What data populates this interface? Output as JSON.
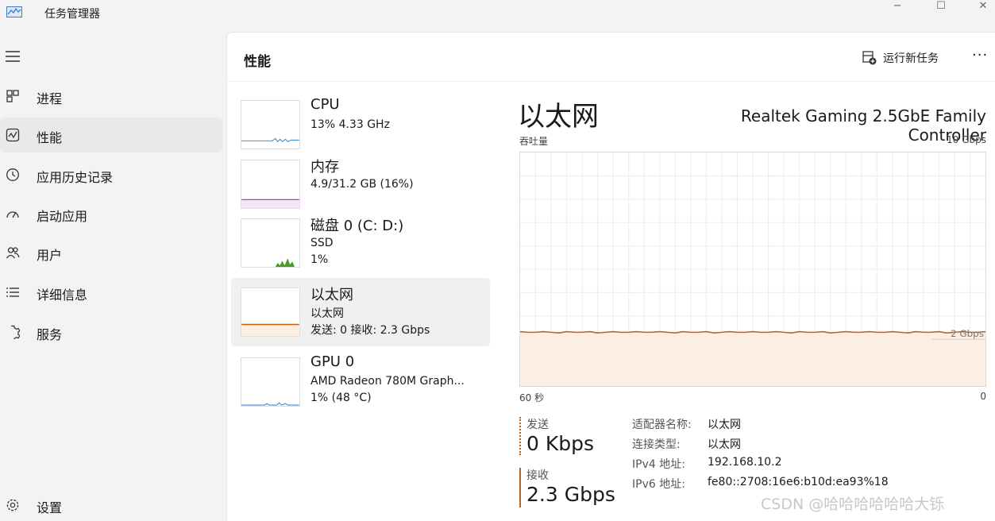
{
  "window": {
    "title": "任务管理器",
    "controls": [
      "−",
      "☐",
      "✕"
    ]
  },
  "sidebar": {
    "items": [
      {
        "label": "进程",
        "icon": "processes-icon"
      },
      {
        "label": "性能",
        "icon": "performance-icon",
        "active": true
      },
      {
        "label": "应用历史记录",
        "icon": "app-history-icon"
      },
      {
        "label": "启动应用",
        "icon": "startup-apps-icon"
      },
      {
        "label": "用户",
        "icon": "users-icon"
      },
      {
        "label": "详细信息",
        "icon": "details-icon"
      },
      {
        "label": "服务",
        "icon": "services-icon"
      }
    ],
    "settings_label": "设置"
  },
  "header": {
    "title": "性能",
    "run_new_task": "运行新任务",
    "more": "···"
  },
  "devices": [
    {
      "name": "CPU",
      "line1": "13% 4.33 GHz",
      "line2": "",
      "color": "#2a7ec9"
    },
    {
      "name": "内存",
      "line1": "4.9/31.2 GB (16%)",
      "line2": "",
      "color": "#9b2fae"
    },
    {
      "name": "磁盘 0 (C: D:)",
      "line1": "SSD",
      "line2": "1%",
      "color": "#4c9a2a"
    },
    {
      "name": "以太网",
      "line1": "以太网",
      "line2": "发送: 0 接收: 2.3 Gbps",
      "color": "#c55a11",
      "selected": true
    },
    {
      "name": "GPU 0",
      "line1": "AMD Radeon 780M Graph...",
      "line2": "1% (48 °C)",
      "color": "#2a7ec9"
    }
  ],
  "detail": {
    "title": "以太网",
    "adapter": "Realtek Gaming 2.5GbE Family Controller",
    "throughput_label": "吞吐量",
    "max_label": "10 Gbps",
    "ref_label": "2 Gbps",
    "time_label": "60 秒",
    "zero_label": "0",
    "graph": {
      "max_gbps": 10,
      "receive_gbps": 2.3,
      "fill_color": "#fbeee2",
      "line_color": "#b8652c"
    },
    "send_label": "发送",
    "send_value": "0 Kbps",
    "recv_label": "接收",
    "recv_value": "2.3 Gbps",
    "info": [
      {
        "key": "适配器名称:",
        "value": "以太网"
      },
      {
        "key": "连接类型:",
        "value": "以太网"
      },
      {
        "key": "IPv4 地址:",
        "value": "192.168.10.2"
      },
      {
        "key": "IPv6 地址:",
        "value": "fe80::2708:16e6:b10d:ea93%18"
      }
    ]
  },
  "watermark": "CSDN @哈哈哈哈哈哈大铄"
}
